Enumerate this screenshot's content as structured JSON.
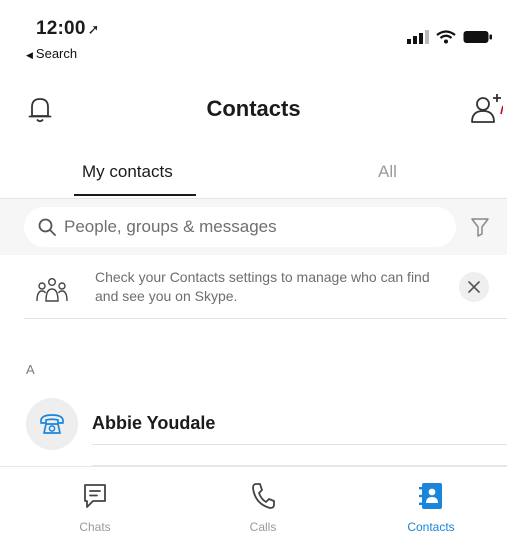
{
  "status_bar": {
    "time": "12:00",
    "location_glyph": "➚",
    "back_label": "Search"
  },
  "header": {
    "title": "Contacts",
    "left_icon": "bell-icon",
    "right_icon": "add-contact-icon"
  },
  "tabs": [
    {
      "label": "My contacts",
      "active": true
    },
    {
      "label": "All",
      "active": false
    }
  ],
  "search": {
    "placeholder": "People, groups & messages",
    "value": ""
  },
  "notice": {
    "text": "Check your Contacts settings to manage who can find and see you on Skype.",
    "icon": "people-group-icon",
    "close_glyph": "✕"
  },
  "contacts": {
    "section_letter": "A",
    "items": [
      {
        "name": "Abbie Youdale",
        "avatar_icon": "telephone-icon"
      }
    ]
  },
  "bottom_nav": [
    {
      "label": "Chats",
      "icon": "chat-icon",
      "active": false
    },
    {
      "label": "Calls",
      "icon": "phone-icon",
      "active": false
    },
    {
      "label": "Contacts",
      "icon": "contacts-icon",
      "active": true
    }
  ],
  "colors": {
    "accent": "#1a86d9",
    "text": "#1b1b1b",
    "muted": "#9a9a9a",
    "search_band": "#f6f6f6"
  }
}
